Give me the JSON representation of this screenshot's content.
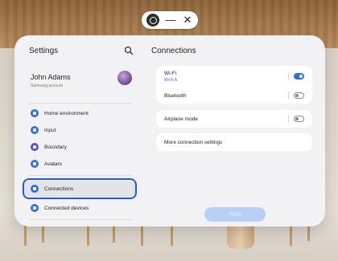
{
  "titlebar": {
    "app_icon": "settings-app-icon",
    "minimize": "—",
    "close": "✕"
  },
  "settings": {
    "title": "Settings",
    "search_icon": "search-icon"
  },
  "profile": {
    "name": "John Adams",
    "subtitle": "Samsung account"
  },
  "menu": [
    {
      "label": "Home environment",
      "icon": "home-icon",
      "color": "#2f6fe0"
    },
    {
      "label": "Input",
      "icon": "keyboard-icon",
      "color": "#2f6fe0"
    },
    {
      "label": "Boundary",
      "icon": "boundary-icon",
      "color": "#5a4fd1"
    },
    {
      "label": "Avatars",
      "icon": "avatar-icon",
      "color": "#2f6fe0"
    },
    {
      "label": "Connections",
      "icon": "wifi-icon",
      "color": "#2f6fe0"
    },
    {
      "label": "Connected devices",
      "icon": "devices-icon",
      "color": "#2f6fe0"
    }
  ],
  "connections": {
    "title": "Connections",
    "wifi": {
      "label": "Wi-Fi",
      "sub": "Wi-Fi A",
      "enabled": true
    },
    "bluetooth": {
      "label": "Bluetooth",
      "enabled": false
    },
    "airplane": {
      "label": "Airplane mode",
      "enabled": false
    },
    "more": {
      "label": "More connection settings"
    }
  },
  "apply_label": "Apply",
  "colors": {
    "accent": "#2f6fe0",
    "focus": "#1e5bd6"
  }
}
